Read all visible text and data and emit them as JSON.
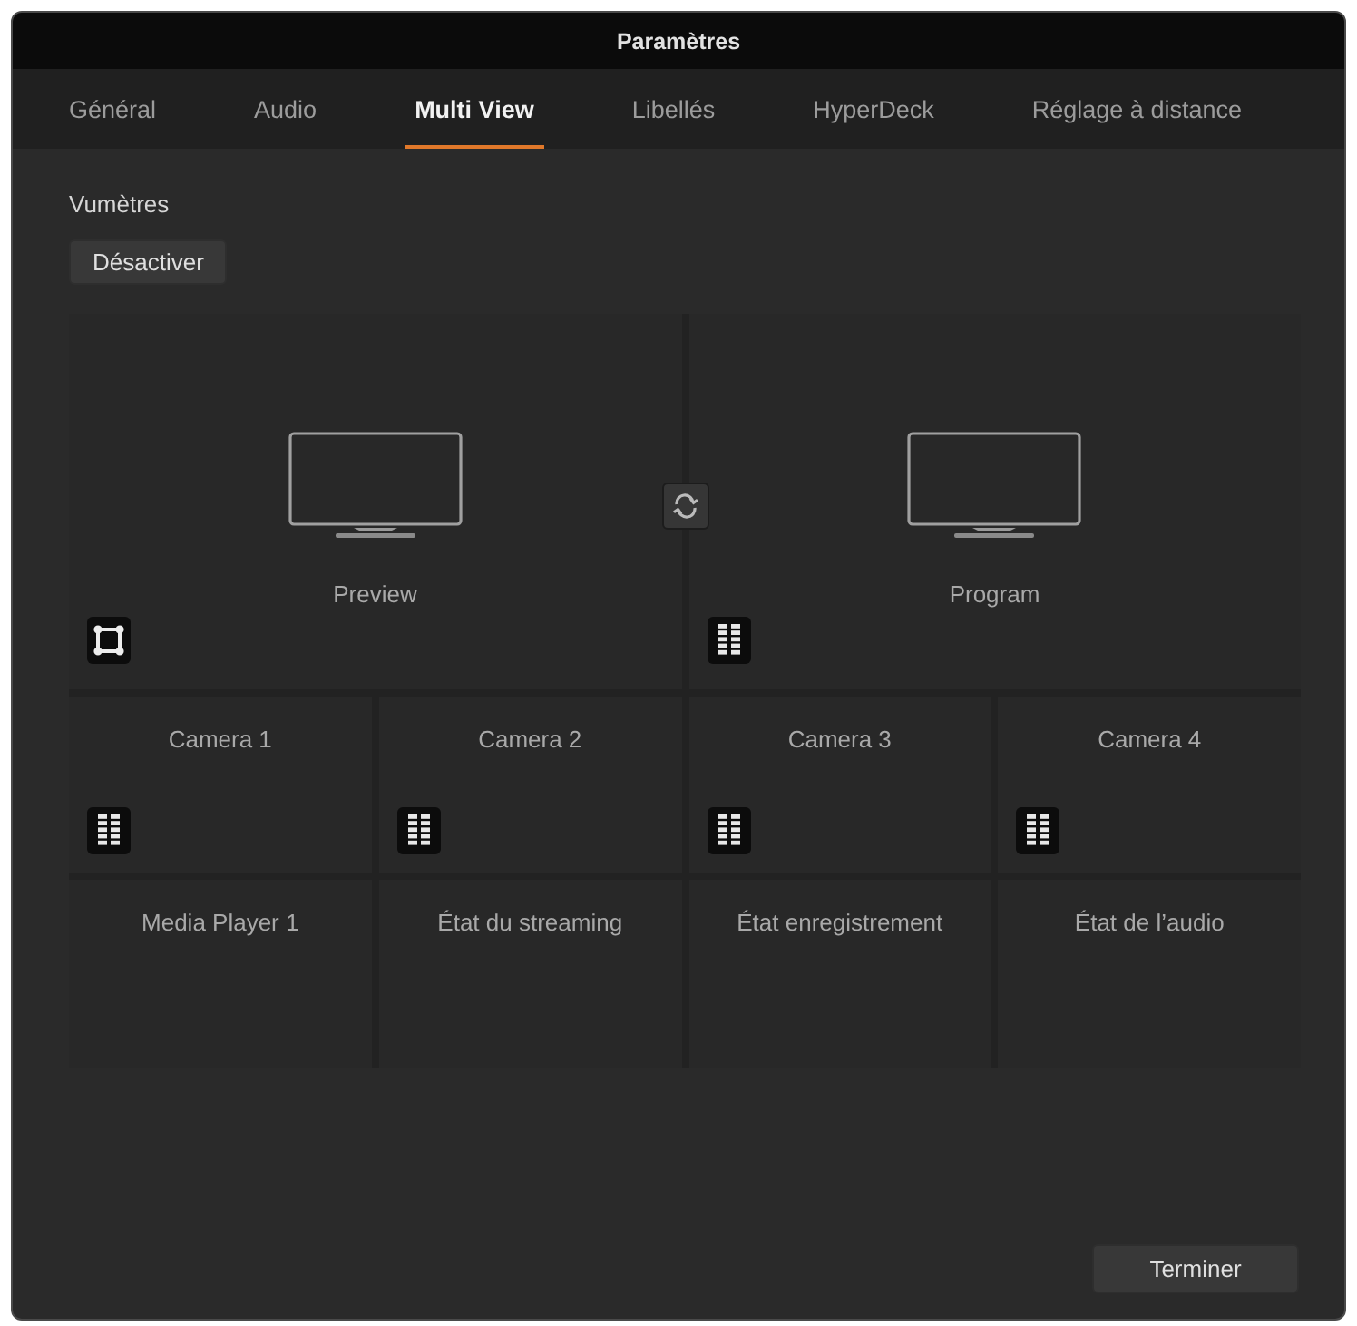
{
  "window": {
    "title": "Paramètres"
  },
  "tabs": [
    {
      "label": "Général",
      "selected": false
    },
    {
      "label": "Audio",
      "selected": false
    },
    {
      "label": "Multi View",
      "selected": true
    },
    {
      "label": "Libellés",
      "selected": false
    },
    {
      "label": "HyperDeck",
      "selected": false
    },
    {
      "label": "Réglage à distance",
      "selected": false
    }
  ],
  "vu_meters": {
    "label": "Vumètres",
    "button": "Désactiver"
  },
  "windows": [
    {
      "label": "Preview",
      "kind": "monitor",
      "toggle": {
        "kind": "safe-area",
        "on": true
      }
    },
    {
      "label": "Program",
      "kind": "monitor",
      "toggle": {
        "kind": "meter",
        "on": true
      }
    },
    {
      "label": "Camera 1",
      "kind": "tile",
      "toggle": {
        "kind": "meter",
        "on": true
      }
    },
    {
      "label": "Camera 2",
      "kind": "tile",
      "toggle": {
        "kind": "meter",
        "on": true
      }
    },
    {
      "label": "Camera 3",
      "kind": "tile",
      "toggle": {
        "kind": "meter",
        "on": true
      }
    },
    {
      "label": "Camera 4",
      "kind": "tile",
      "toggle": {
        "kind": "meter",
        "on": true
      }
    },
    {
      "label": "Media Player 1",
      "kind": "tile"
    },
    {
      "label": "État du streaming",
      "kind": "tile"
    },
    {
      "label": "État enregistrement",
      "kind": "tile"
    },
    {
      "label": "État de l’audio",
      "kind": "tile"
    }
  ],
  "footer": {
    "button": "Terminer"
  }
}
